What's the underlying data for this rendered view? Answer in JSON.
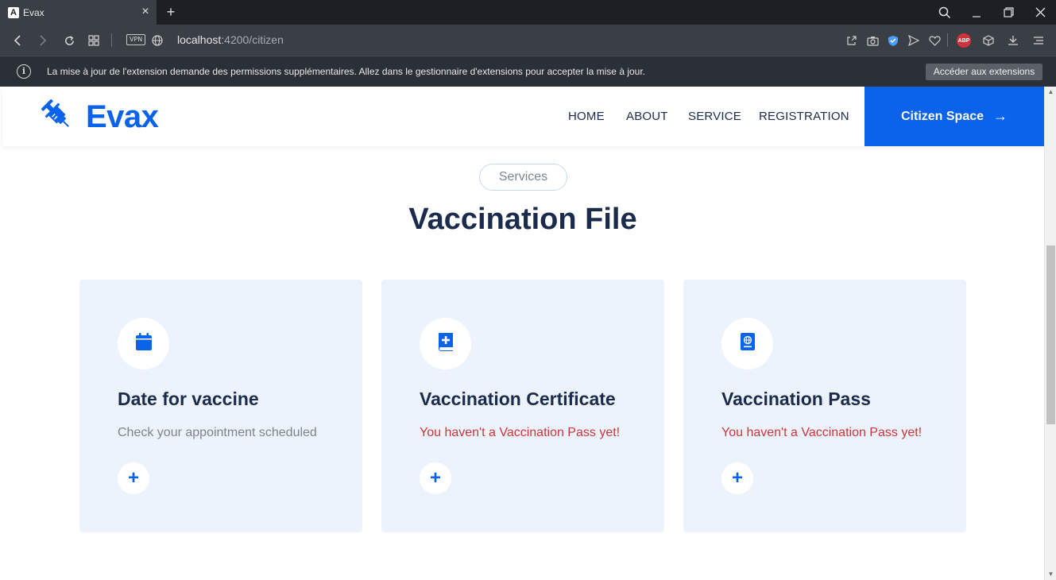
{
  "browser": {
    "tab_title": "Evax",
    "tab_favicon": "A",
    "url_host": "localhost",
    "url_path": ":4200/citizen",
    "vpn_label": "VPN",
    "abp_label": "ABP",
    "info_message": "La mise à jour de l'extension demande des permissions supplémentaires. Allez dans le gestionnaire d'extensions pour accepter la mise à jour.",
    "info_button": "Accéder aux extensions"
  },
  "site": {
    "logo_text": "Evax",
    "nav": [
      "HOME",
      "ABOUT",
      "SERVICE",
      "REGISTRATION"
    ],
    "cta_label": "Citizen Space",
    "cta_icon": "→",
    "brand_color": "#0a63ea"
  },
  "section": {
    "pill": "Services",
    "title": "Vaccination File"
  },
  "cards": [
    {
      "icon": "calendar-icon",
      "title": "Date for vaccine",
      "desc": "Check your appointment scheduled",
      "desc_style": "muted"
    },
    {
      "icon": "medical-book-icon",
      "title": "Vaccination Certificate",
      "desc": "You haven't a Vaccination Pass yet!",
      "desc_style": "alert"
    },
    {
      "icon": "passport-icon",
      "title": "Vaccination Pass",
      "desc": "You haven't a Vaccination Pass yet!",
      "desc_style": "alert"
    }
  ],
  "plus_label": "+"
}
